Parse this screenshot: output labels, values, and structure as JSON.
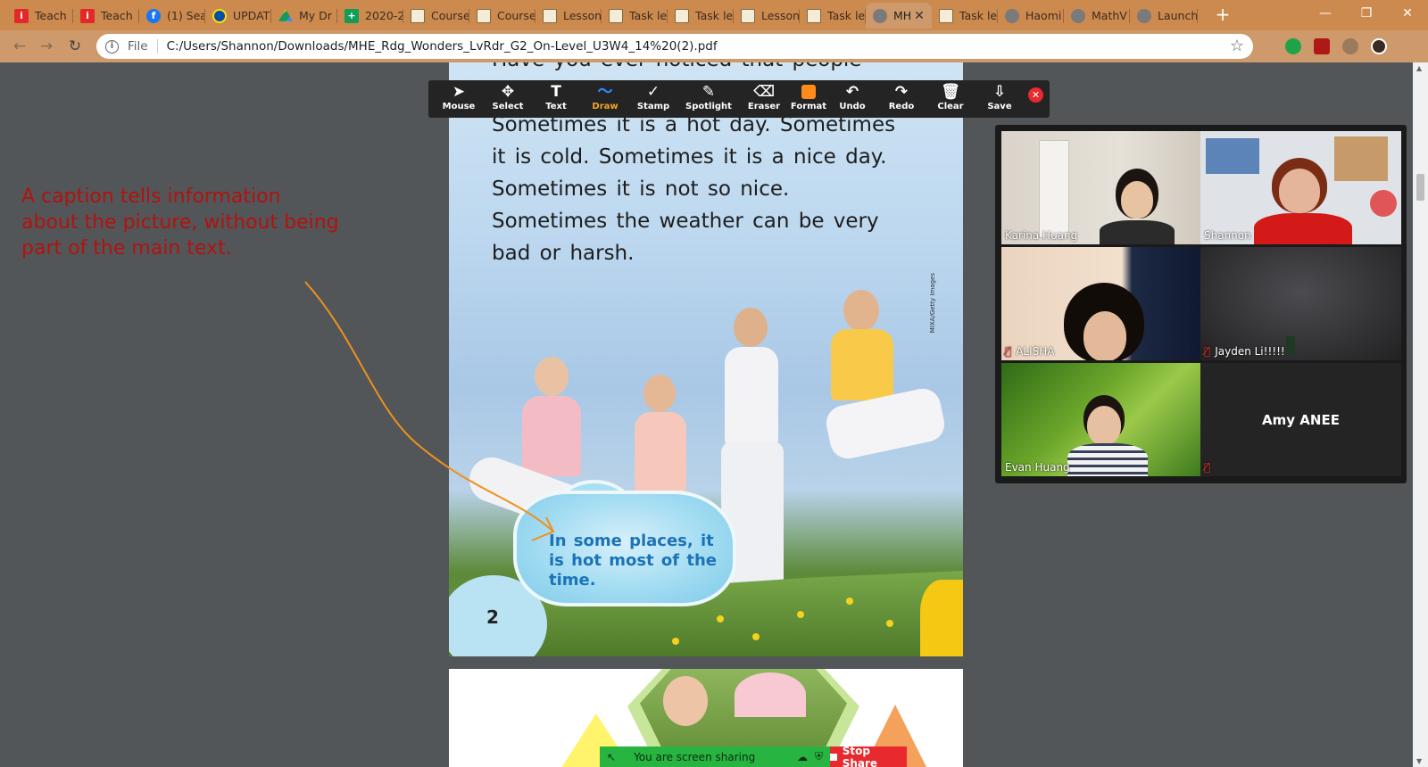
{
  "browser": {
    "tabs": [
      {
        "label": "Teach",
        "favicon": "instructure-icon"
      },
      {
        "label": "Teach",
        "favicon": "instructure-icon"
      },
      {
        "label": "(1) Sea",
        "favicon": "facebook-icon"
      },
      {
        "label": "UPDAT",
        "favicon": "lidl-icon"
      },
      {
        "label": "My Dr",
        "favicon": "drive-icon"
      },
      {
        "label": "2020-2",
        "favicon": "sheets-icon"
      },
      {
        "label": "Course",
        "favicon": "course-icon"
      },
      {
        "label": "Course",
        "favicon": "course-icon"
      },
      {
        "label": "Lesson",
        "favicon": "course-icon"
      },
      {
        "label": "Task le",
        "favicon": "course-icon"
      },
      {
        "label": "Task le",
        "favicon": "course-icon"
      },
      {
        "label": "Lesson",
        "favicon": "course-icon"
      },
      {
        "label": "Task le",
        "favicon": "course-icon"
      },
      {
        "label": "MH",
        "favicon": "globe-icon",
        "active": true
      },
      {
        "label": "Task le",
        "favicon": "course-icon"
      },
      {
        "label": "Haomi",
        "favicon": "globe-icon"
      },
      {
        "label": "MathV",
        "favicon": "globe-icon"
      },
      {
        "label": "Launch",
        "favicon": "globe-icon"
      }
    ],
    "new_tab": "+",
    "window_controls": {
      "minimize": "—",
      "maximize": "❐",
      "close": "✕"
    },
    "address": {
      "chip": "File",
      "url": "C:/Users/Shannon/Downloads/MHE_Rdg_Wonders_LvRdr_G2_On-Level_U3W4_14%20(2).pdf"
    }
  },
  "annotation_toolbar": {
    "tools": [
      {
        "label": "Mouse",
        "glyph": "➤"
      },
      {
        "label": "Select",
        "glyph": "✥"
      },
      {
        "label": "Text",
        "glyph": "T"
      },
      {
        "label": "Draw",
        "glyph": "〜",
        "active": true
      },
      {
        "label": "Stamp",
        "glyph": "✓"
      },
      {
        "label": "Spotlight",
        "glyph": "✎"
      },
      {
        "label": "Eraser",
        "glyph": "⌫"
      },
      {
        "label": "Format",
        "glyph": ""
      },
      {
        "label": "Undo",
        "glyph": "↶"
      },
      {
        "label": "Redo",
        "glyph": "↷"
      },
      {
        "label": "Clear",
        "glyph": "🗑"
      },
      {
        "label": "Save",
        "glyph": "⇩"
      }
    ],
    "format_color": "#ff8c1a",
    "close": "✕"
  },
  "annotation": {
    "text": "A caption tells information about the picture, without being part of the main text.",
    "color": "#b3120e",
    "arrow_color": "#f0901e"
  },
  "pdf": {
    "cut_line": "Have you ever noticed that people",
    "body": "Sometimes it is a hot day. Sometimes it is cold. Sometimes it is a nice day. Sometimes it is not so nice. Sometimes the weather can be very bad or harsh.",
    "credit": "MIXA/Getty Images",
    "caption": "In some places, it is hot most of the time.",
    "page_number": "2"
  },
  "gallery": {
    "participants": [
      {
        "name": "Karina Huang",
        "muted": false,
        "speaking": true
      },
      {
        "name": "Shannon",
        "muted": false
      },
      {
        "name": "ALISHA",
        "muted": true
      },
      {
        "name": "Jayden Li!!!!!",
        "muted": true
      },
      {
        "name": "Evan Huang",
        "muted": false
      },
      {
        "name": "Amy ANEE",
        "muted": true,
        "video_off": true
      }
    ]
  },
  "share_bar": {
    "status": "You are screen sharing",
    "stop": "Stop Share"
  }
}
